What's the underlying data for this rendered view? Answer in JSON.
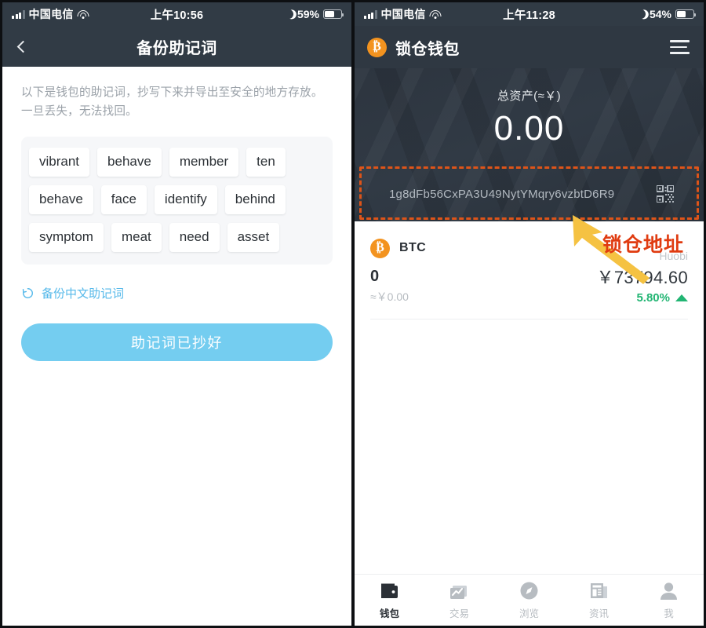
{
  "left_phone": {
    "status_bar": {
      "carrier": "中国电信",
      "time": "上午10:56",
      "battery_percent": "59%",
      "signal_icon": "signal-bars-icon",
      "wifi_icon": "wifi-icon",
      "dnd_icon": "moon-icon",
      "battery_icon": "battery-icon",
      "battery_fill": 59
    },
    "nav": {
      "back_icon": "chevron-left-icon",
      "title": "备份助记词"
    },
    "description": "以下是钱包的助记词，抄写下来并导出至安全的地方存放。一旦丢失，无法找回。",
    "mnemonic_words": [
      "vibrant",
      "behave",
      "member",
      "ten",
      "behave",
      "face",
      "identify",
      "behind",
      "symptom",
      "meat",
      "need",
      "asset"
    ],
    "switch_language_link": {
      "icon": "refresh-icon",
      "label": "备份中文助记词",
      "color": "#56b9ea"
    },
    "primary_button": {
      "label": "助记词已抄好",
      "color": "#74cdf0"
    }
  },
  "right_phone": {
    "status_bar": {
      "carrier": "中国电信",
      "time": "上午11:28",
      "battery_percent": "54%",
      "signal_icon": "signal-bars-icon",
      "wifi_icon": "wifi-icon",
      "dnd_icon": "moon-icon",
      "battery_icon": "battery-icon",
      "battery_fill": 54
    },
    "app_bar": {
      "logo_icon": "bitcoin-logo-icon",
      "logo_symbol": "₿",
      "title": "锁仓钱包",
      "menu_icon": "hamburger-menu-icon"
    },
    "hero": {
      "total_label": "总资产(≈￥)",
      "total_amount": "0.00",
      "address": "1g8dFb56CxPA3U49NytYMqry6vzbtD6R9",
      "qr_icon": "qr-code-icon",
      "highlight_color": "#dd5419"
    },
    "coin": {
      "logo_icon": "bitcoin-logo-icon",
      "logo_symbol": "₿",
      "name": "BTC",
      "source": "Huobi",
      "balance": "0",
      "balance_fiat": "≈￥0.00",
      "price": "￥73794.60",
      "change": "5.80%",
      "change_direction_icon": "caret-up-icon",
      "change_color": "#22b573"
    },
    "tabs": [
      {
        "label": "钱包",
        "icon": "wallet-icon",
        "active": true
      },
      {
        "label": "交易",
        "icon": "chart-icon",
        "active": false
      },
      {
        "label": "浏览",
        "icon": "compass-icon",
        "active": false
      },
      {
        "label": "资讯",
        "icon": "newspaper-icon",
        "active": false
      },
      {
        "label": "我",
        "icon": "person-icon",
        "active": false
      }
    ]
  },
  "annotation": {
    "label": "锁仓地址",
    "label_color": "#e03b10",
    "arrow_icon": "arrow-up-left-icon",
    "arrow_color": "#f5c242"
  }
}
